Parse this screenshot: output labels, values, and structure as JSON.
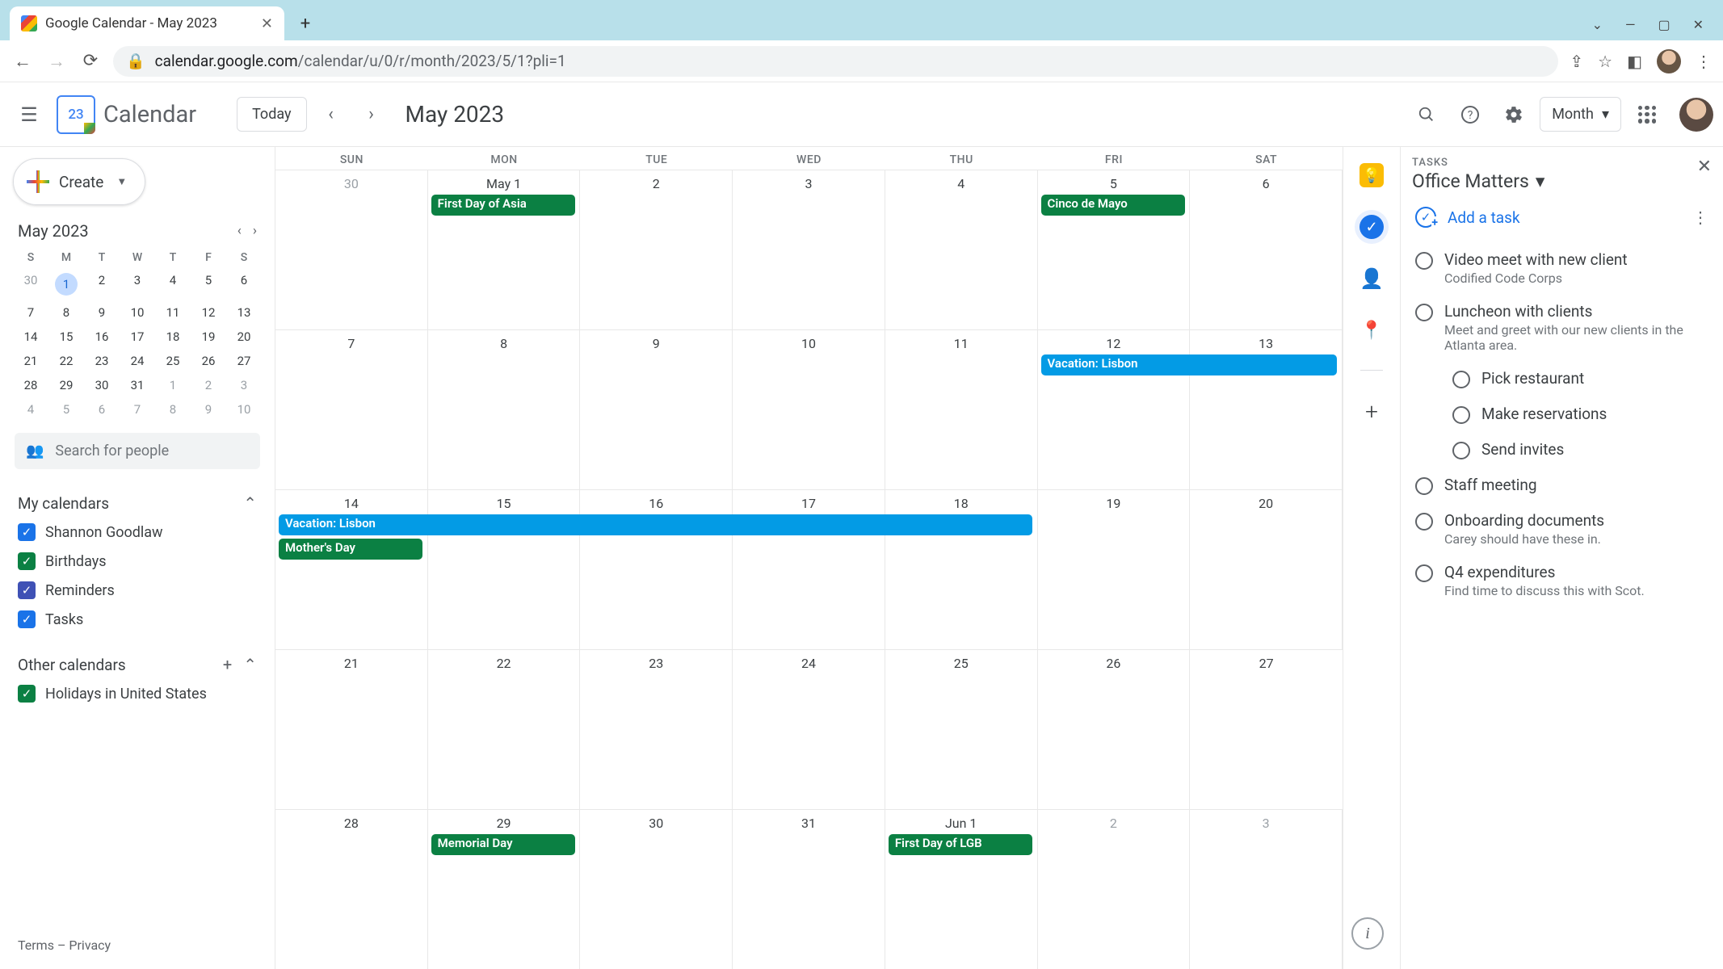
{
  "browser": {
    "tab_title": "Google Calendar - May 2023",
    "url_host": "calendar.google.com",
    "url_path": "/calendar/u/0/r/month/2023/5/1?pli=1"
  },
  "header": {
    "app_name": "Calendar",
    "logo_day": "23",
    "today_label": "Today",
    "month_title": "May 2023",
    "view_label": "Month"
  },
  "create_label": "Create",
  "mini": {
    "title": "May 2023",
    "dow": [
      "S",
      "M",
      "T",
      "W",
      "T",
      "F",
      "S"
    ],
    "days": [
      {
        "n": "30",
        "muted": true
      },
      {
        "n": "1",
        "sel": true
      },
      {
        "n": "2"
      },
      {
        "n": "3"
      },
      {
        "n": "4"
      },
      {
        "n": "5"
      },
      {
        "n": "6"
      },
      {
        "n": "7"
      },
      {
        "n": "8"
      },
      {
        "n": "9"
      },
      {
        "n": "10"
      },
      {
        "n": "11"
      },
      {
        "n": "12"
      },
      {
        "n": "13"
      },
      {
        "n": "14"
      },
      {
        "n": "15"
      },
      {
        "n": "16"
      },
      {
        "n": "17"
      },
      {
        "n": "18"
      },
      {
        "n": "19"
      },
      {
        "n": "20"
      },
      {
        "n": "21"
      },
      {
        "n": "22"
      },
      {
        "n": "23"
      },
      {
        "n": "24"
      },
      {
        "n": "25"
      },
      {
        "n": "26"
      },
      {
        "n": "27"
      },
      {
        "n": "28"
      },
      {
        "n": "29"
      },
      {
        "n": "30"
      },
      {
        "n": "31"
      },
      {
        "n": "1",
        "muted": true
      },
      {
        "n": "2",
        "muted": true
      },
      {
        "n": "3",
        "muted": true
      },
      {
        "n": "4",
        "muted": true
      },
      {
        "n": "5",
        "muted": true
      },
      {
        "n": "6",
        "muted": true
      },
      {
        "n": "7",
        "muted": true
      },
      {
        "n": "8",
        "muted": true
      },
      {
        "n": "9",
        "muted": true
      },
      {
        "n": "10",
        "muted": true
      }
    ]
  },
  "search_placeholder": "Search for people",
  "my_cals": {
    "title": "My calendars",
    "items": [
      {
        "label": "Shannon Goodlaw",
        "color": "blue"
      },
      {
        "label": "Birthdays",
        "color": "green"
      },
      {
        "label": "Reminders",
        "color": "purple"
      },
      {
        "label": "Tasks",
        "color": "blue"
      }
    ]
  },
  "other_cals": {
    "title": "Other calendars",
    "items": [
      {
        "label": "Holidays in United States",
        "color": "green"
      }
    ]
  },
  "footer": {
    "terms": "Terms",
    "privacy": "Privacy"
  },
  "dow": [
    "SUN",
    "MON",
    "TUE",
    "WED",
    "THU",
    "FRI",
    "SAT"
  ],
  "weeks": [
    {
      "days": [
        "30",
        "May 1",
        "2",
        "3",
        "4",
        "5",
        "6"
      ],
      "muted": [
        0
      ],
      "events": [
        {
          "label": "First Day of Asia",
          "col": 1,
          "span": 1,
          "color": "green",
          "row": 1
        },
        {
          "label": "Cinco de Mayo",
          "col": 5,
          "span": 1,
          "color": "green",
          "row": 1
        }
      ]
    },
    {
      "days": [
        "7",
        "8",
        "9",
        "10",
        "11",
        "12",
        "13"
      ],
      "events": [
        {
          "label": "Vacation: Lisbon",
          "col": 5,
          "span": 2,
          "color": "blue",
          "row": 1
        }
      ]
    },
    {
      "days": [
        "14",
        "15",
        "16",
        "17",
        "18",
        "19",
        "20"
      ],
      "events": [
        {
          "label": "Vacation: Lisbon",
          "col": 0,
          "span": 5,
          "color": "blue",
          "row": 1
        },
        {
          "label": "Mother's Day",
          "col": 0,
          "span": 1,
          "color": "green",
          "row": 2
        }
      ]
    },
    {
      "days": [
        "21",
        "22",
        "23",
        "24",
        "25",
        "26",
        "27"
      ],
      "events": []
    },
    {
      "days": [
        "28",
        "29",
        "30",
        "31",
        "Jun 1",
        "2",
        "3"
      ],
      "muted": [
        5,
        6
      ],
      "events": [
        {
          "label": "Memorial Day",
          "col": 1,
          "span": 1,
          "color": "green",
          "row": 1
        },
        {
          "label": "First Day of LGB",
          "col": 4,
          "span": 1,
          "color": "green",
          "row": 1
        }
      ]
    }
  ],
  "tasks": {
    "header_label": "TASKS",
    "list_name": "Office Matters",
    "add_label": "Add a task",
    "items": [
      {
        "title": "Video meet with new client",
        "desc": "Codified Code Corps"
      },
      {
        "title": "Luncheon with clients",
        "desc": "Meet and greet with our new clients in the Atlanta area.",
        "sub": [
          {
            "title": "Pick restaurant"
          },
          {
            "title": "Make reservations"
          },
          {
            "title": "Send invites"
          }
        ]
      },
      {
        "title": "Staff meeting"
      },
      {
        "title": "Onboarding documents",
        "desc": "Carey should have these in."
      },
      {
        "title": "Q4 expenditures",
        "desc": "Find time to discuss this with Scot."
      }
    ]
  }
}
